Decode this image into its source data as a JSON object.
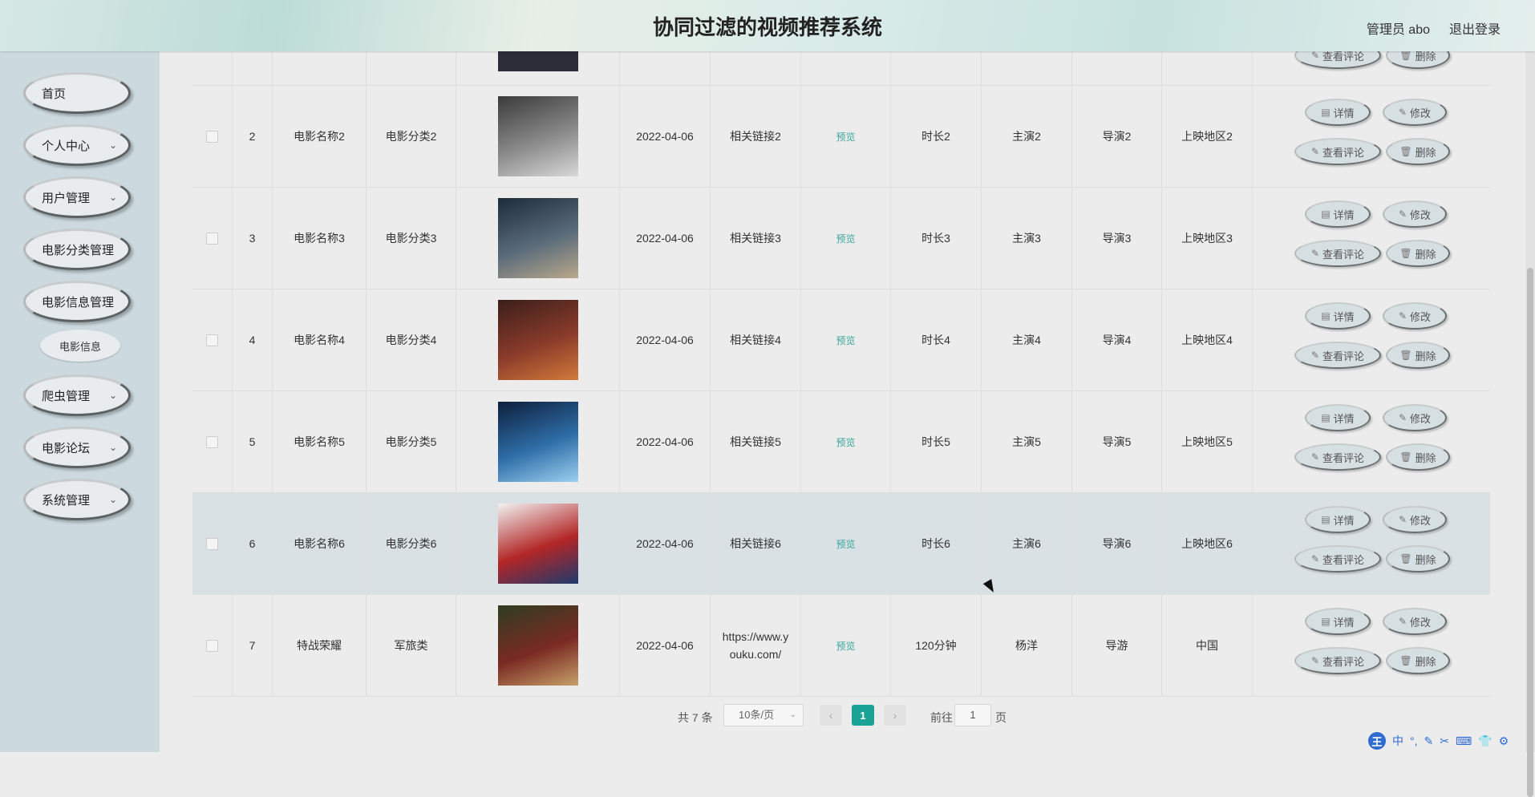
{
  "header": {
    "title": "协同过滤的视频推荐系统",
    "admin": "管理员 abo",
    "logout": "退出登录"
  },
  "sidebar": {
    "items": [
      {
        "label": "首页"
      },
      {
        "label": "个人中心"
      },
      {
        "label": "用户管理"
      },
      {
        "label": "电影分类管理"
      },
      {
        "label": "电影信息管理"
      },
      {
        "label": "爬虫管理"
      },
      {
        "label": "电影论坛"
      },
      {
        "label": "系统管理"
      }
    ],
    "sub_item": "电影信息",
    "chevron": "⌄"
  },
  "actions": {
    "detail": "详情",
    "edit": "修改",
    "comments": "查看评论",
    "delete": "删除"
  },
  "rows": [
    {
      "no": "2",
      "name": "电影名称2",
      "category": "电影分类2",
      "date": "2022-04-06",
      "link": "相关链接2",
      "preview": "预览",
      "duration": "时长2",
      "actor": "主演2",
      "director": "导演2",
      "region": "上映地区2"
    },
    {
      "no": "3",
      "name": "电影名称3",
      "category": "电影分类3",
      "date": "2022-04-06",
      "link": "相关链接3",
      "preview": "预览",
      "duration": "时长3",
      "actor": "主演3",
      "director": "导演3",
      "region": "上映地区3"
    },
    {
      "no": "4",
      "name": "电影名称4",
      "category": "电影分类4",
      "date": "2022-04-06",
      "link": "相关链接4",
      "preview": "预览",
      "duration": "时长4",
      "actor": "主演4",
      "director": "导演4",
      "region": "上映地区4"
    },
    {
      "no": "5",
      "name": "电影名称5",
      "category": "电影分类5",
      "date": "2022-04-06",
      "link": "相关链接5",
      "preview": "预览",
      "duration": "时长5",
      "actor": "主演5",
      "director": "导演5",
      "region": "上映地区5"
    },
    {
      "no": "6",
      "name": "电影名称6",
      "category": "电影分类6",
      "date": "2022-04-06",
      "link": "相关链接6",
      "preview": "预览",
      "duration": "时长6",
      "actor": "主演6",
      "director": "导演6",
      "region": "上映地区6"
    },
    {
      "no": "7",
      "name": "特战荣耀",
      "category": "军旅类",
      "date": "2022-04-06",
      "link": "https://www.youku.com/",
      "preview": "预览",
      "duration": "120分钟",
      "actor": "杨洋",
      "director": "导游",
      "region": "中国"
    }
  ],
  "pagination": {
    "total": "共 7 条",
    "page_size": "10条/页",
    "current": "1",
    "goto": "前往",
    "goto_value": "1",
    "page_unit": "页",
    "prev": "‹",
    "next": "›"
  },
  "ime": {
    "logo": "王",
    "mode": "中"
  }
}
